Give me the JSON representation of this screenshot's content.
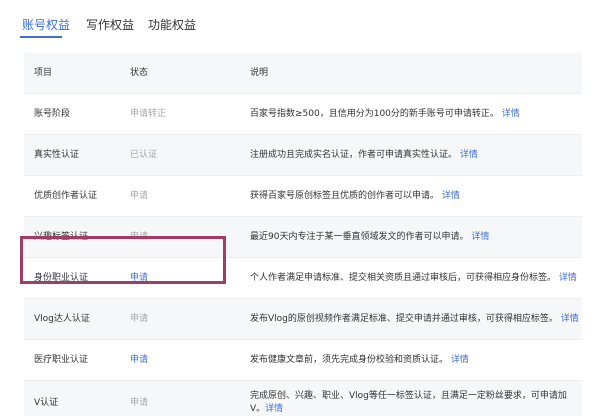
{
  "tabs": [
    {
      "label": "账号权益",
      "active": true
    },
    {
      "label": "写作权益",
      "active": false
    },
    {
      "label": "功能权益",
      "active": false
    }
  ],
  "table": {
    "headers": {
      "item": "项目",
      "status": "状态",
      "desc": "说明"
    },
    "rows": [
      {
        "item": "账号阶段",
        "status": "申请转正",
        "desc": "百家号指数≥500，且信用分为100分的新手账号可申请转正。",
        "link": "详情"
      },
      {
        "item": "真实性认证",
        "status": "已认证",
        "desc": "注册成功且完成实名认证，作者可申请真实性认证。",
        "link": "详情"
      },
      {
        "item": "优质创作者认证",
        "status": "申请",
        "desc": "获得百家号原创标签且优质的创作者可以申请。",
        "link": "详情"
      },
      {
        "item": "兴趣标签认证",
        "status": "申请",
        "desc": "最近90天内专注于某一垂直领域发文的作者可以申请。",
        "link": "详情"
      },
      {
        "item": "身份职业认证",
        "status": "申请",
        "desc": "个人作者满足申请标准、提交相关资质且通过审核后，可获得相应身份标签。",
        "link": "详情"
      },
      {
        "item": "Vlog达人认证",
        "status": "申请",
        "desc": "发布Vlog的原创视频作者满足标准、提交申请并通过审核，可获得相应标签。",
        "link": "详情"
      },
      {
        "item": "医疗职业认证",
        "status": "申请",
        "desc": "发布健康文章前，须先完成身份校验和资质认证。",
        "link": "详情"
      },
      {
        "item": "V认证",
        "status": "申请",
        "desc_line1": "完成原创、兴趣、职业、Vlog等任一标签认证，且满足一定粉丝要求，可申请加V。",
        "desc_line2": "",
        "link": "详情"
      }
    ]
  },
  "colors": {
    "accent": "#3b6fd6",
    "highlight": "#a13c64"
  }
}
